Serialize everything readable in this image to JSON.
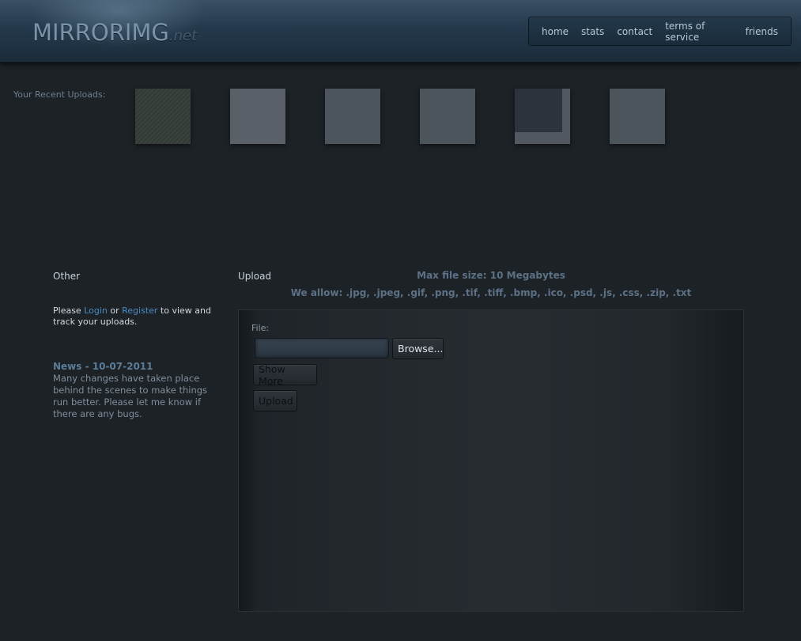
{
  "header": {
    "logo_main": "MIRRORIMG",
    "logo_tld": ".net",
    "nav": [
      "home",
      "stats",
      "contact",
      "terms of service",
      "friends"
    ]
  },
  "recent": {
    "label": "Your Recent Uploads:"
  },
  "sidebar": {
    "heading": "Other",
    "login_prefix": "Please ",
    "login_link": "Login",
    "login_or": " or ",
    "register_link": "Register",
    "login_suffix": " to view and track your uploads.",
    "news_title": "News - 10-07-2011",
    "news_body": "Many changes have taken place behind the scenes to make things run better. Please let me know if there are any bugs."
  },
  "upload": {
    "heading": "Upload",
    "max_size": "Max file size: 10 Megabytes",
    "allowed": "We allow: .jpg, .jpeg, .gif, .png, .tif, .tiff, .bmp, .ico, .psd, .js, .css, .zip, .txt",
    "file_label": "File:",
    "browse_label": "Browse...",
    "show_more_label": "Show More",
    "upload_label": "Upload"
  },
  "colors": {
    "background": "#1d2227",
    "link": "#4b8bc2",
    "header": "#24394c"
  }
}
